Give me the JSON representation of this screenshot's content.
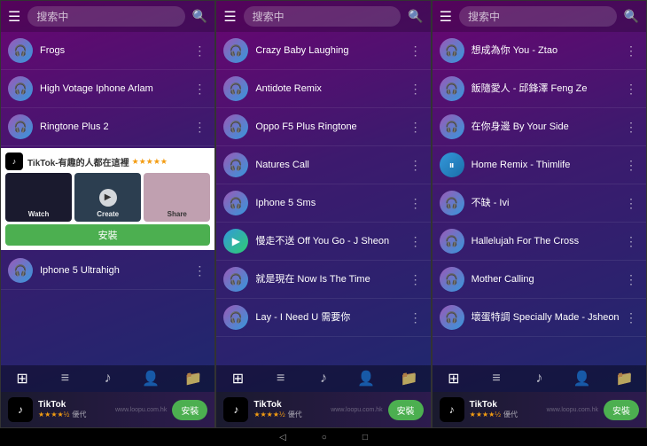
{
  "screens": [
    {
      "id": "screen1",
      "header": {
        "search_placeholder": "搜索中"
      },
      "songs": [
        {
          "id": "s1_1",
          "title": "Frogs",
          "icon_type": "headphone"
        },
        {
          "id": "s1_2",
          "title": "High Votage Iphone Arlam",
          "icon_type": "headphone"
        },
        {
          "id": "s1_3",
          "title": "Ringtone Plus 2",
          "icon_type": "headphone"
        },
        {
          "id": "s1_4",
          "title": "Iphone 5 Ultrahigh",
          "icon_type": "headphone"
        }
      ],
      "ad": {
        "title": "TikTok-有趣的人都在這裡",
        "stars": "★★★★★",
        "labels": [
          "Watch",
          "Create",
          "Share"
        ],
        "install": "安裝"
      },
      "nav_items": [
        "⊞",
        "≡",
        "♪",
        "👤",
        "📁"
      ]
    },
    {
      "id": "screen2",
      "header": {
        "search_placeholder": "搜索中"
      },
      "songs": [
        {
          "id": "s2_1",
          "title": "Crazy Baby Laughing",
          "icon_type": "headphone"
        },
        {
          "id": "s2_2",
          "title": "Antidote Remix",
          "icon_type": "headphone"
        },
        {
          "id": "s2_3",
          "title": "Oppo F5 Plus Ringtone",
          "icon_type": "headphone"
        },
        {
          "id": "s2_4",
          "title": "Natures Call",
          "icon_type": "headphone"
        },
        {
          "id": "s2_5",
          "title": "Iphone 5 Sms",
          "icon_type": "headphone"
        },
        {
          "id": "s2_6",
          "title": "慢走不送 Off You Go - J Sheon",
          "icon_type": "playing"
        },
        {
          "id": "s2_7",
          "title": "就是現在 Now Is The Time",
          "icon_type": "headphone"
        },
        {
          "id": "s2_8",
          "title": "Lay - I Need U 需要你",
          "icon_type": "headphone"
        }
      ],
      "nav_items": [
        "⊞",
        "≡",
        "♪",
        "👤",
        "📁"
      ]
    },
    {
      "id": "screen3",
      "header": {
        "search_placeholder": "搜索中"
      },
      "songs": [
        {
          "id": "s3_1",
          "title": "想成為你 You - Ztao",
          "icon_type": "headphone"
        },
        {
          "id": "s3_2",
          "title": "飯隨愛人 - 邱鋒澤 Feng Ze",
          "icon_type": "headphone"
        },
        {
          "id": "s3_3",
          "title": "在你身邊 By Your Side",
          "icon_type": "headphone"
        },
        {
          "id": "s3_4",
          "title": "Home Remix - Thimlife",
          "icon_type": "pause"
        },
        {
          "id": "s3_5",
          "title": "不缺 - Ivi",
          "icon_type": "headphone"
        },
        {
          "id": "s3_6",
          "title": "Hallelujah For The Cross",
          "icon_type": "headphone"
        },
        {
          "id": "s3_7",
          "title": "Mother Calling",
          "icon_type": "headphone"
        },
        {
          "id": "s3_8",
          "title": "壞蛋特調 Specially Made - Jsheon",
          "icon_type": "headphone"
        }
      ],
      "nav_items": [
        "⊞",
        "≡",
        "♪",
        "👤",
        "📁"
      ]
    }
  ],
  "bottom_ad": {
    "app_name": "TikTok",
    "rating": "4.5",
    "stars": "★★★★½",
    "rating_label": "優代",
    "install_label": "安裝",
    "watermark": "www.loopu.com.hk"
  },
  "system_nav": {
    "back": "◁",
    "home": "○",
    "recent": "□"
  },
  "icons": {
    "headphone": "🎧",
    "playing": "▶",
    "pause": "⏸",
    "menu": "☰",
    "search": "🔍",
    "more": "⋮"
  }
}
